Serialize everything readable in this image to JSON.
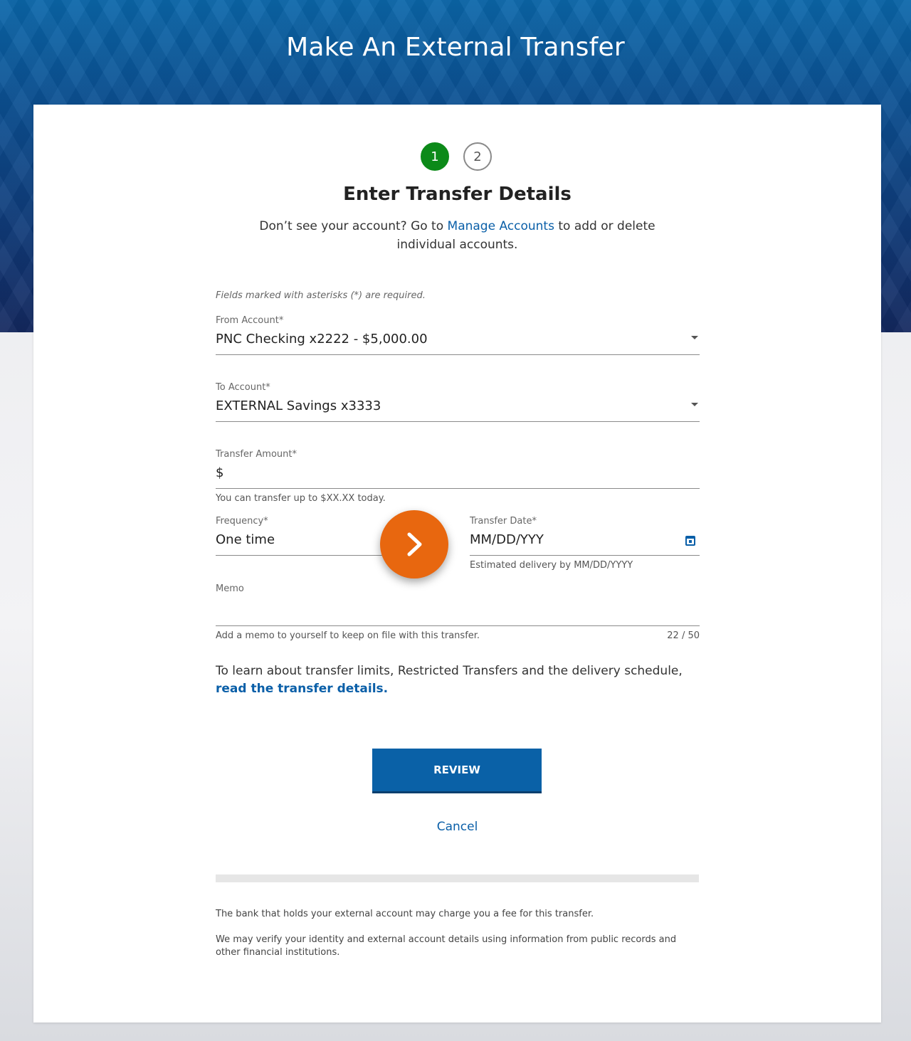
{
  "header": {
    "title": "Make An External Transfer"
  },
  "stepper": {
    "step1": "1",
    "step2": "2"
  },
  "card": {
    "heading": "Enter Transfer Details",
    "intro_before": "Don’t see your account? Go to ",
    "intro_link": "Manage Accounts",
    "intro_after": " to add or delete individual accounts."
  },
  "form": {
    "required_note": "Fields marked with asterisks (*) are required.",
    "from_account": {
      "label": "From Account*",
      "value": "PNC Checking x2222 - $5,000.00"
    },
    "to_account": {
      "label": "To Account*",
      "value": "EXTERNAL Savings x3333"
    },
    "amount": {
      "label": "Transfer Amount*",
      "prefix": "$",
      "hint": "You can transfer up to $XX.XX today."
    },
    "frequency": {
      "label": "Frequency*",
      "value": "One time"
    },
    "transfer_date": {
      "label": "Transfer Date*",
      "value": "MM/DD/YYY",
      "hint": "Estimated delivery by MM/DD/YYYY"
    },
    "memo": {
      "label": "Memo",
      "hint": "Add a memo to yourself to keep on file with this transfer.",
      "count": "22 / 50"
    }
  },
  "limits": {
    "text": "To learn about transfer limits, Restricted Transfers and the delivery schedule, ",
    "link": "read the transfer details."
  },
  "actions": {
    "review": "REVIEW",
    "cancel": "Cancel"
  },
  "disclaimers": [
    "The bank that holds your external account may charge you a fee for this transfer.",
    "We may verify your identity and external account details using information from public records and other financial institutions."
  ],
  "colors": {
    "accent": "#0a61a7",
    "step_active": "#0c8a19",
    "fab": "#e8670f"
  }
}
